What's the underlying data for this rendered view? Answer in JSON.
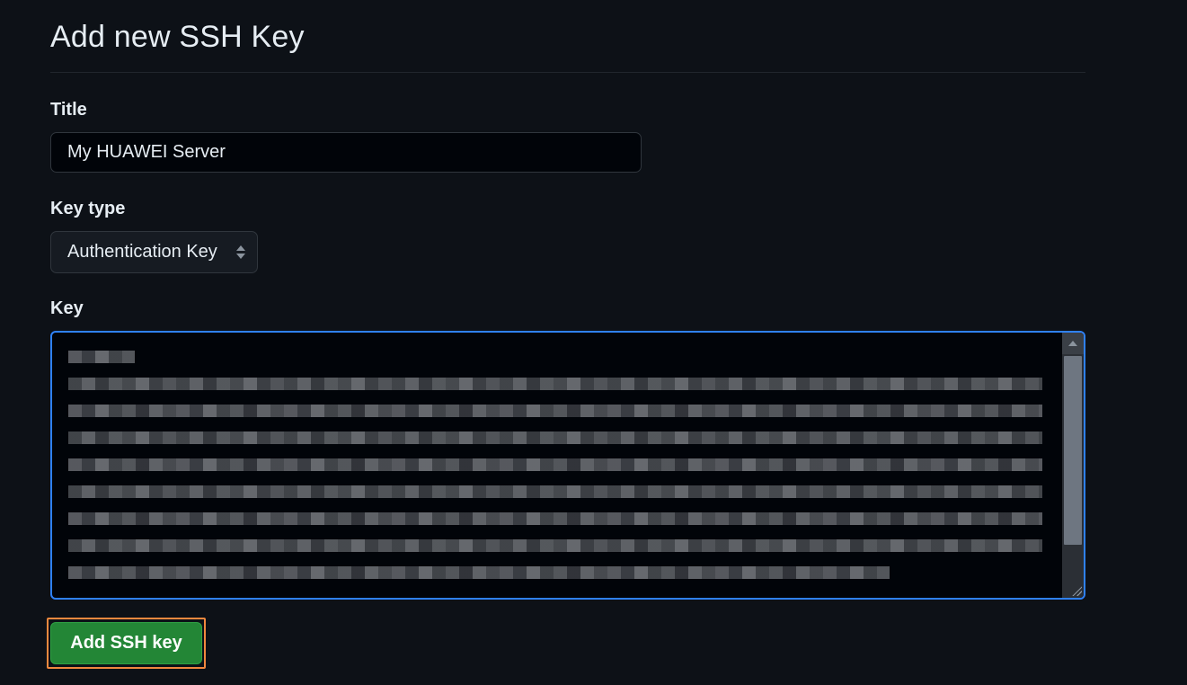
{
  "page": {
    "title": "Add new SSH Key"
  },
  "form": {
    "title_label": "Title",
    "title_value": "My HUAWEI Server",
    "key_type_label": "Key type",
    "key_type_value": "Authentication Key",
    "key_label": "Key",
    "key_value_redacted": true
  },
  "actions": {
    "submit_label": "Add SSH key"
  },
  "colors": {
    "background": "#0d1117",
    "focus_border": "#2f81f7",
    "primary_button": "#238636",
    "highlight_outline": "#f0883e"
  }
}
